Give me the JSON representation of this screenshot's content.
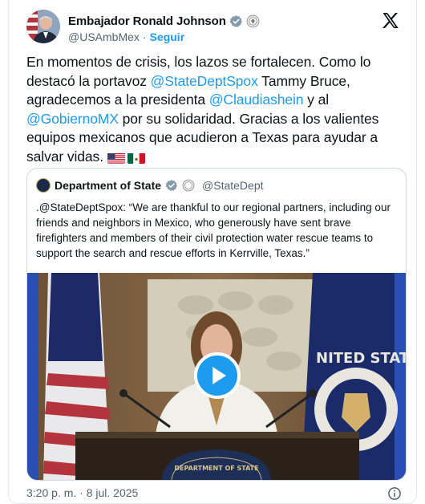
{
  "author": {
    "name": "Embajador Ronald Johnson",
    "handle": "@USAmbMex",
    "separator": "·",
    "follow_label": "Seguir"
  },
  "tweet": {
    "segments": [
      {
        "text": "En momentos de crisis, los lazos se fortalecen. Como lo destacó la portavoz ",
        "mention": false
      },
      {
        "text": "@StateDeptSpox",
        "mention": true
      },
      {
        "text": " Tammy Bruce, agradecemos a la presidenta ",
        "mention": false
      },
      {
        "text": "@Claudiashein",
        "mention": true
      },
      {
        "text": " y al ",
        "mention": false
      },
      {
        "text": "@GobiernoMX",
        "mention": true
      },
      {
        "text": " por su solidaridad. Gracias a los valientes equipos mexicanos que acudieron a Texas para ayudar a salvar vidas. ",
        "mention": false
      }
    ],
    "flags": [
      "us-flag",
      "mexico-flag"
    ]
  },
  "quote": {
    "name": "Department of State",
    "handle": "@StateDept",
    "text": ".@StateDeptSpox: “We are thankful to our regional partners, including our friends and neighbors in Mexico, who generously have sent brave firefighters and members of their civil protection water rescue teams to support the search and rescue efforts in Kerrville, Texas.”",
    "video_seal_text": "DEPARTMENT OF STATE",
    "video_seal_right": "NITED STATE"
  },
  "timestamp": "3:20 p. m. · 8 jul. 2025",
  "colors": {
    "accent": "#1d9bf0",
    "text": "#0f1419",
    "muted": "#536471"
  }
}
